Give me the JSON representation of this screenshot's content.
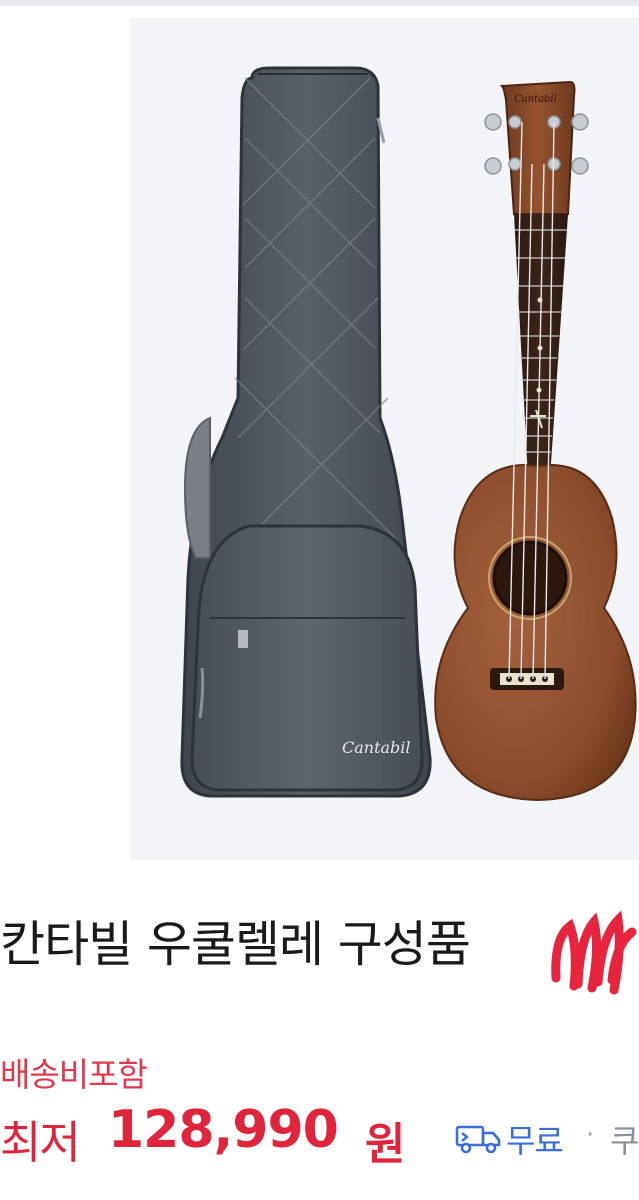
{
  "product": {
    "title": "칸타빌 우쿨렐레 구성품",
    "bag_logo_text": "Cantabil",
    "headstock_logo_text": "Cantabil"
  },
  "shipping": {
    "label": "배송비포함"
  },
  "price": {
    "label": "최저",
    "value": "128,990",
    "unit": "원"
  },
  "delivery": {
    "free_label": "무료",
    "separator": "·",
    "next_label": "쿠"
  },
  "colors": {
    "price_red": "#e0243b",
    "shipping_red": "#e03a4e",
    "free_blue": "#3a6fd8",
    "scribble_red": "#e8233d"
  },
  "icons": [
    "delivery-truck-icon"
  ]
}
